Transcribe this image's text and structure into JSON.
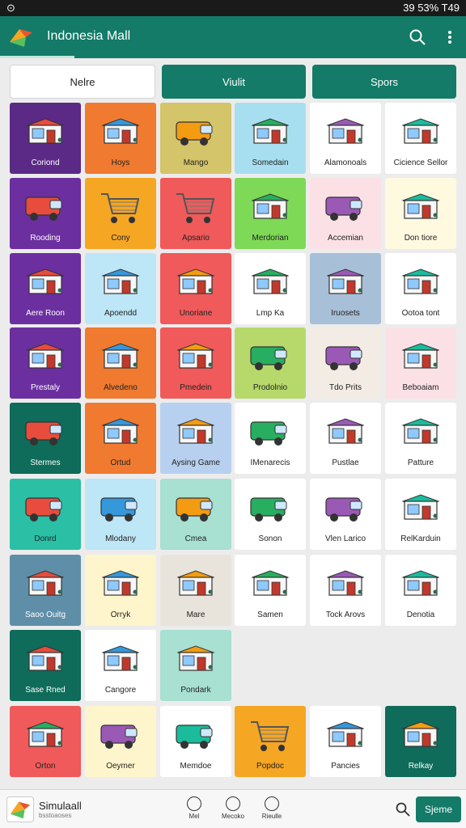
{
  "status_bar": {
    "left": "⊙",
    "right": "39 53% T49"
  },
  "app_bar": {
    "title": "Indonesia Mall"
  },
  "tabs": [
    {
      "label": "Nelre",
      "active": true
    },
    {
      "label": "Viulit",
      "active": false
    },
    {
      "label": "Spors",
      "active": false
    }
  ],
  "tiles": [
    {
      "label": "Coriond",
      "bg": "#5b2a86",
      "icon": "store-icon"
    },
    {
      "label": "Hoys",
      "bg": "#f07a2f",
      "icon": "store-icon"
    },
    {
      "label": "Mango",
      "bg": "#d4c46a",
      "icon": "van-icon"
    },
    {
      "label": "Somedain",
      "bg": "#a8dff0",
      "icon": "store-icon"
    },
    {
      "label": "Alamonoals",
      "bg": "#ffffff",
      "icon": "store-icon"
    },
    {
      "label": "Cicience Sellor",
      "bg": "#ffffff",
      "icon": "store-icon"
    },
    {
      "label": "Rooding",
      "bg": "#6b2fa0",
      "icon": "van-icon"
    },
    {
      "label": "Cony",
      "bg": "#f5a623",
      "icon": "cart-icon"
    },
    {
      "label": "Apsario",
      "bg": "#f05a5a",
      "icon": "cart-icon"
    },
    {
      "label": "Merdorian",
      "bg": "#7ed957",
      "icon": "store-icon"
    },
    {
      "label": "Accemian",
      "bg": "#fbe1e6",
      "icon": "van-icon"
    },
    {
      "label": "Don tiore",
      "bg": "#fff9e0",
      "icon": "store-icon"
    },
    {
      "label": "Aere Roon",
      "bg": "#6b2fa0",
      "icon": "store-icon"
    },
    {
      "label": "Apoendd",
      "bg": "#bde6f7",
      "icon": "store-icon"
    },
    {
      "label": "Unoriane",
      "bg": "#f05a5a",
      "icon": "store-icon"
    },
    {
      "label": "Lmp Ka",
      "bg": "#ffffff",
      "icon": "store-icon"
    },
    {
      "label": "Iruosets",
      "bg": "#a8bfd8",
      "icon": "store-icon"
    },
    {
      "label": "Ootoa tont",
      "bg": "#ffffff",
      "icon": "store-icon"
    },
    {
      "label": "Prestaly",
      "bg": "#6b2fa0",
      "icon": "store-icon"
    },
    {
      "label": "Alvedeno",
      "bg": "#f07a2f",
      "icon": "store-icon"
    },
    {
      "label": "Pmedein",
      "bg": "#f05a5a",
      "icon": "store-icon"
    },
    {
      "label": "Prodolnio",
      "bg": "#b7d96b",
      "icon": "van-icon"
    },
    {
      "label": "Tdo Prits",
      "bg": "#f2ece4",
      "icon": "van-icon"
    },
    {
      "label": "Beboaiam",
      "bg": "#fbe1e6",
      "icon": "store-icon"
    },
    {
      "label": "Stermes",
      "bg": "#0f6b5a",
      "icon": "van-icon"
    },
    {
      "label": "Ortud",
      "bg": "#f07a2f",
      "icon": "store-icon"
    },
    {
      "label": "Aysing Game",
      "bg": "#b8d0f0",
      "icon": "store-icon"
    },
    {
      "label": "IMenarecis",
      "bg": "#ffffff",
      "icon": "van-icon"
    },
    {
      "label": "Pustlae",
      "bg": "#ffffff",
      "icon": "store-icon"
    },
    {
      "label": "Patture",
      "bg": "#ffffff",
      "icon": "store-icon"
    },
    {
      "label": "Donrd",
      "bg": "#2bbfa5",
      "icon": "van-icon"
    },
    {
      "label": "Mlodany",
      "bg": "#bde6f7",
      "icon": "van-icon"
    },
    {
      "label": "Cmea",
      "bg": "#a8e0d2",
      "icon": "van-icon"
    },
    {
      "label": "Sonon",
      "bg": "#ffffff",
      "icon": "van-icon"
    },
    {
      "label": "Vlen Larico",
      "bg": "#ffffff",
      "icon": "van-icon"
    },
    {
      "label": "RelKarduin",
      "bg": "#ffffff",
      "icon": "store-icon"
    },
    {
      "label": "Saoo Ouitg",
      "bg": "#5f8fa8",
      "icon": "store-icon"
    },
    {
      "label": "Orryk",
      "bg": "#fff5cc",
      "icon": "store-icon"
    },
    {
      "label": "Mare",
      "bg": "#e8e4dc",
      "icon": "store-icon"
    },
    {
      "label": "Samen",
      "bg": "#ffffff",
      "icon": "store-icon"
    },
    {
      "label": "Tock Arovs",
      "bg": "#ffffff",
      "icon": "store-icon"
    },
    {
      "label": "Denotia",
      "bg": "#ffffff",
      "icon": "store-icon"
    },
    {
      "label": "Sase Rned",
      "bg": "#0f6b5a",
      "icon": "store-icon"
    },
    {
      "label": "Cangore",
      "bg": "#ffffff",
      "icon": "store-icon"
    },
    {
      "label": "Pondark",
      "bg": "#a8e0d2",
      "icon": "store-icon"
    },
    {
      "label": "Orton",
      "bg": "#f05a5a",
      "icon": "store-icon"
    },
    {
      "label": "Oeymer",
      "bg": "#fff5cc",
      "icon": "van-icon"
    },
    {
      "label": "Memdoe",
      "bg": "#ffffff",
      "icon": "van-icon"
    },
    {
      "label": "Popdoc",
      "bg": "#f5a623",
      "icon": "cart-icon"
    },
    {
      "label": "Pancies",
      "bg": "#ffffff",
      "icon": "store-icon"
    },
    {
      "label": "Relkay",
      "bg": "#0f6b5a",
      "icon": "store-icon"
    }
  ],
  "bottom_bar": {
    "app_name": "Simulaall",
    "app_sub": "bsstoaoses",
    "nav": [
      {
        "label": "Mel"
      },
      {
        "label": "Mecoko"
      },
      {
        "label": "Rieulle"
      }
    ],
    "primary": "Sjeme"
  }
}
